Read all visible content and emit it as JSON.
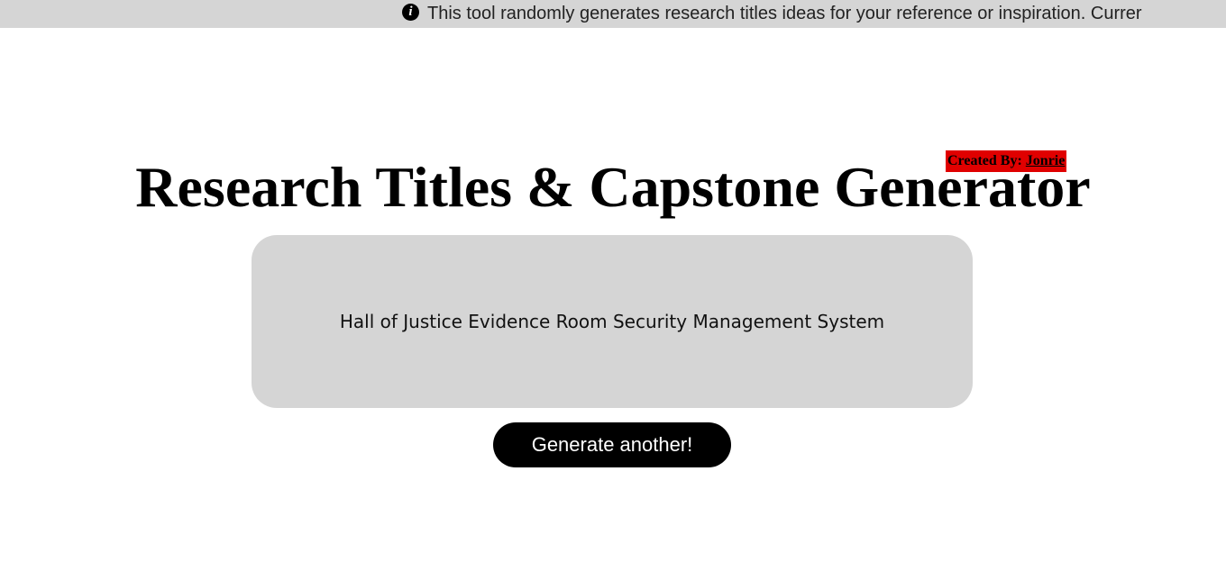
{
  "notice": {
    "icon": "info-icon",
    "text": "This tool randomly generates research titles ideas for your reference or inspiration. Currer"
  },
  "credit": {
    "prefix": "Created By: ",
    "author": "Jonrie",
    "background_color": "#e00000"
  },
  "header": {
    "title": "Research Titles & Capstone Generator"
  },
  "generator": {
    "current_title": "Hall of Justice Evidence Room Security Management System",
    "button_label": "Generate another!"
  }
}
